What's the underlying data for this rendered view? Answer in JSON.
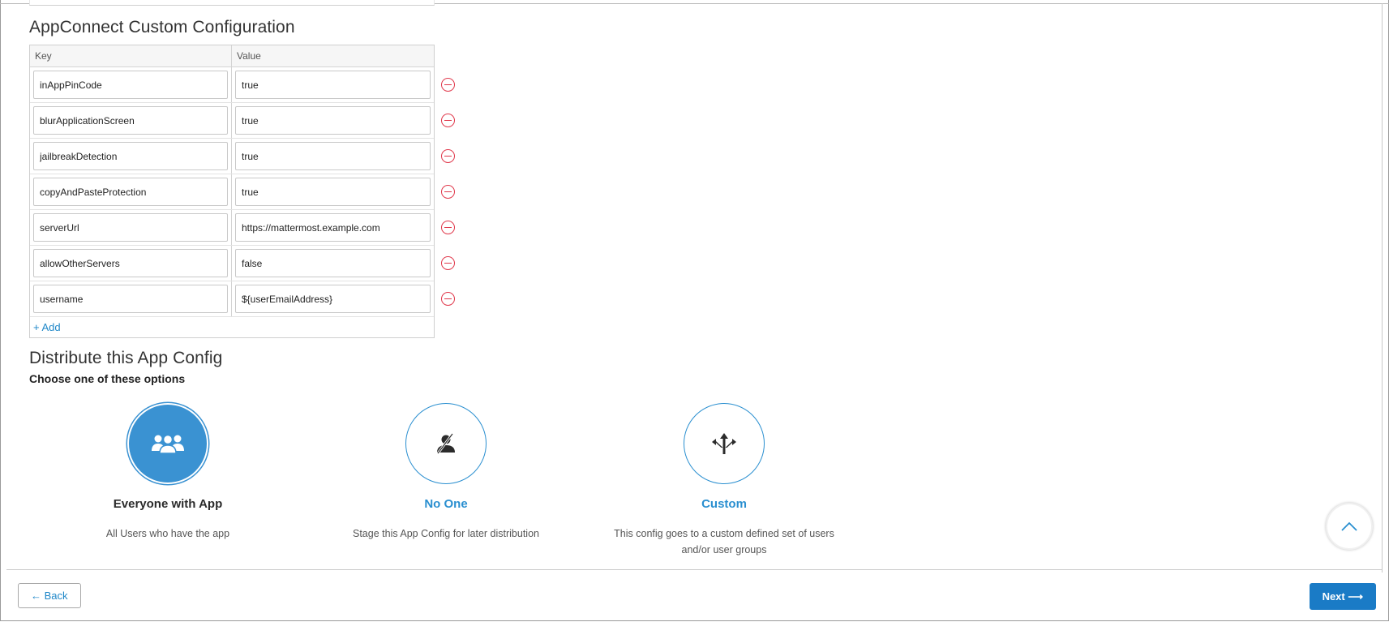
{
  "config_section": {
    "title": "AppConnect Custom Configuration",
    "headers": {
      "key": "Key",
      "value": "Value"
    },
    "rows": [
      {
        "key": "inAppPinCode",
        "value": "true"
      },
      {
        "key": "blurApplicationScreen",
        "value": "true"
      },
      {
        "key": "jailbreakDetection",
        "value": "true"
      },
      {
        "key": "copyAndPasteProtection",
        "value": "true"
      },
      {
        "key": "serverUrl",
        "value": "https://mattermost.example.com"
      },
      {
        "key": "allowOtherServers",
        "value": "false"
      },
      {
        "key": "username",
        "value": "${userEmailAddress}"
      }
    ],
    "add_label": "+ Add"
  },
  "distribute_section": {
    "title": "Distribute this App Config",
    "subtitle": "Choose one of these options",
    "options": [
      {
        "title": "Everyone with App",
        "description": "All Users who have the app",
        "icon": "users-group-icon",
        "selected": true
      },
      {
        "title": "No One",
        "description": "Stage this App Config for later distribution",
        "icon": "no-user-icon",
        "selected": false
      },
      {
        "title": "Custom",
        "description": "This config goes to a custom defined set of users and/or user groups",
        "icon": "split-arrows-icon",
        "selected": false
      }
    ]
  },
  "footer": {
    "back_label": "← Back",
    "next_label": "Next ⟶"
  },
  "colors": {
    "accent": "#1a7bc6",
    "selected_circle": "#3a92d2",
    "remove": "#e0384b"
  }
}
